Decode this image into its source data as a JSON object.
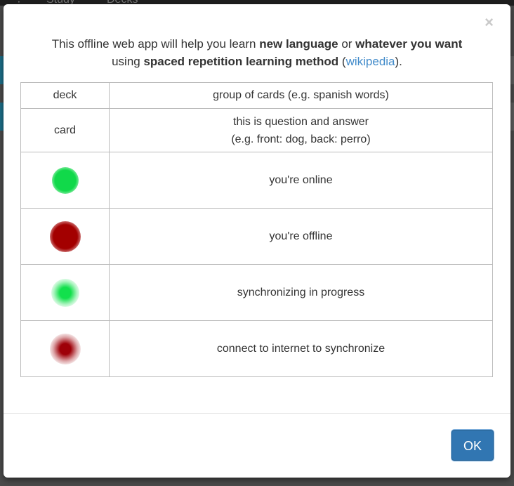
{
  "background": {
    "nav_tabs": [
      "Study",
      "Decks"
    ]
  },
  "modal": {
    "close_glyph": "×",
    "intro": {
      "t1": "This offline web app will help you learn ",
      "b1": "new language",
      "t2": " or ",
      "b2": "whatever you want",
      "t3": "using ",
      "b3": "spaced repetition learning method",
      "t4": " (",
      "link": "wikipedia",
      "t5": ")."
    },
    "legend": {
      "rows": [
        {
          "term": "deck",
          "desc": "group of cards (e.g. spanish words)"
        },
        {
          "term": "card",
          "desc_line1": "this is question and answer",
          "desc_line2": "(e.g. front: dog, back: perro)"
        },
        {
          "icon": "online-status-icon",
          "desc": "you're online"
        },
        {
          "icon": "offline-status-icon",
          "desc": "you're offline"
        },
        {
          "icon": "syncing-status-icon",
          "desc": "synchronizing in progress"
        },
        {
          "icon": "connect-to-sync-icon",
          "desc": "connect to internet to synchronize"
        }
      ]
    },
    "ok_label": "OK"
  },
  "colors": {
    "online": "#11d94a",
    "offline": "#a30000",
    "primary_button": "#3176b2",
    "link": "#428bca"
  }
}
